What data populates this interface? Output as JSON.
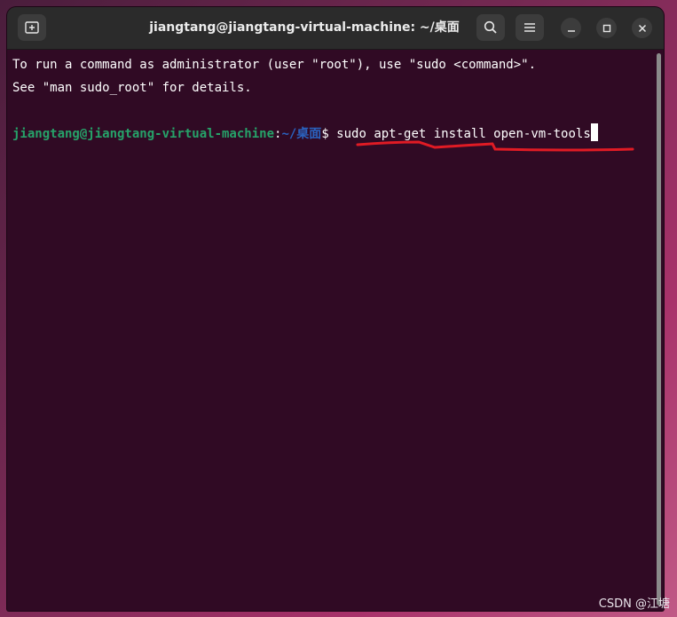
{
  "window": {
    "title": "jiangtang@jiangtang-virtual-machine: ~/桌面"
  },
  "terminal": {
    "lines": [
      "To run a command as administrator (user \"root\"), use \"sudo <command>\".",
      "See \"man sudo_root\" for details.",
      ""
    ],
    "prompt": {
      "user_host": "jiangtang@jiangtang-virtual-machine",
      "separator": ":",
      "path": "~/桌面",
      "symbol": "$ ",
      "command": "sudo apt-get install open-vm-tools"
    }
  },
  "watermark": "CSDN @江塘",
  "colors": {
    "terminal_bg": "#300a24",
    "user_host": "#26a269",
    "path": "#2a63c0",
    "annotation": "#e01b24"
  }
}
